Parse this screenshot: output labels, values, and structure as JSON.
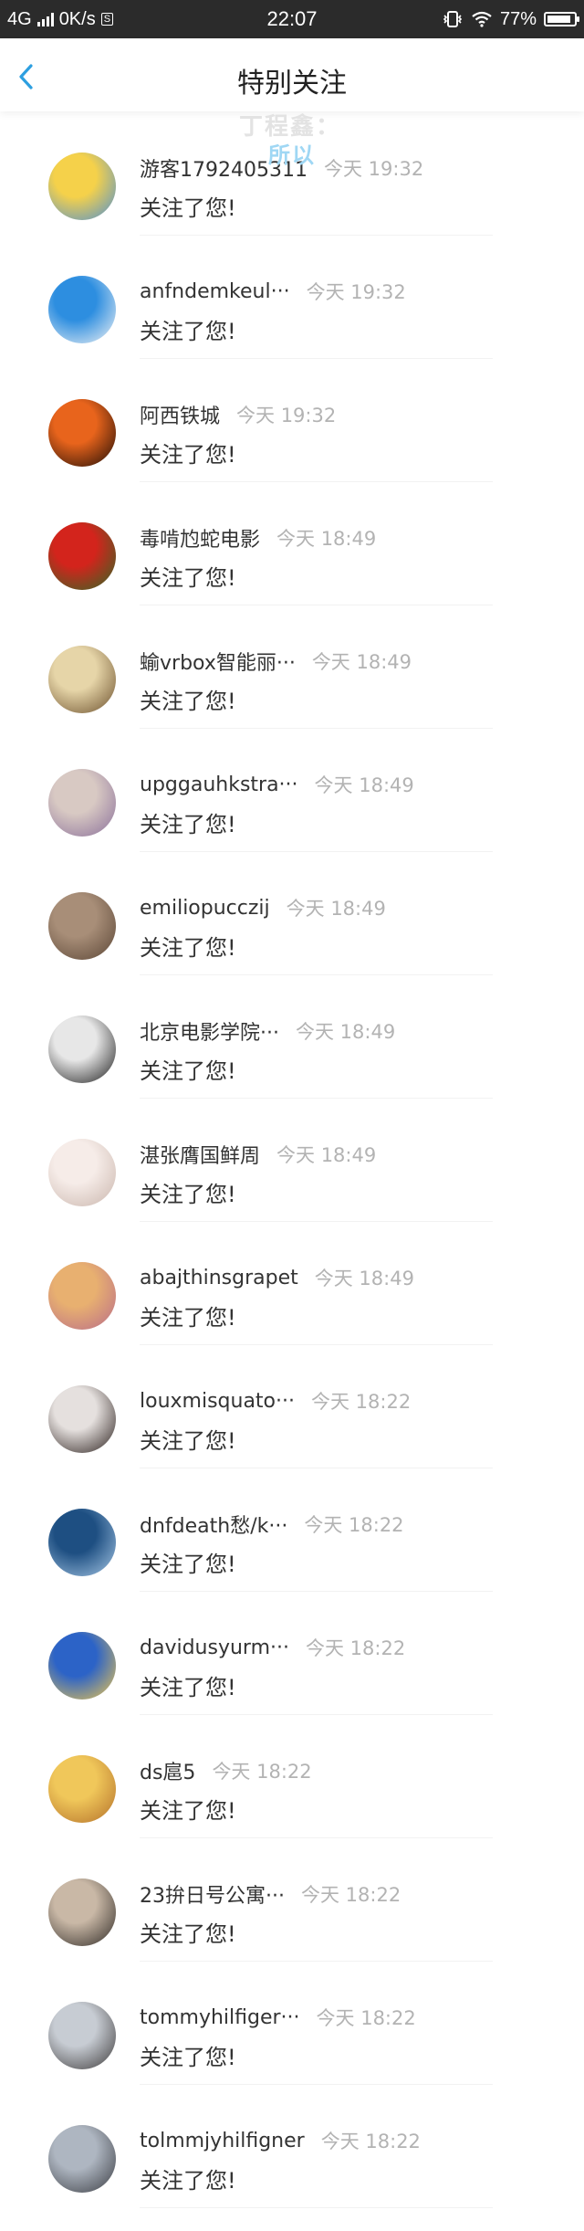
{
  "status_bar": {
    "network": "4G",
    "speed": "0K/s",
    "s_badge": "S",
    "time": "22:07",
    "battery": "77%",
    "battery_level": 0.77
  },
  "header": {
    "title": "特别关注"
  },
  "overlay": {
    "line1": "丁程鑫：",
    "line2": "所以"
  },
  "items": [
    {
      "name": "游客1792405311",
      "time": "今天 19:32",
      "message": "关注了您!",
      "avatar_colors": [
        "#f5d14a",
        "#4c8fd6"
      ]
    },
    {
      "name": "anfndemkeul···",
      "time": "今天 19:32",
      "message": "关注了您!",
      "avatar_colors": [
        "#2d8ee0",
        "#f4f4f4"
      ]
    },
    {
      "name": "阿西铁城",
      "time": "今天 19:32",
      "message": "关注了您!",
      "avatar_colors": [
        "#e8641c",
        "#1b0b05"
      ]
    },
    {
      "name": "毒啃尥蛇电影",
      "time": "今天 18:49",
      "message": "关注了您!",
      "avatar_colors": [
        "#d3241c",
        "#2d6a25"
      ]
    },
    {
      "name": "蝓vrbox智能丽···",
      "time": "今天 18:49",
      "message": "关注了您!",
      "avatar_colors": [
        "#e6d5a8",
        "#6b4f2c"
      ]
    },
    {
      "name": "upggauhkstra···",
      "time": "今天 18:49",
      "message": "关注了您!",
      "avatar_colors": [
        "#d8c9c3",
        "#8a6f9a"
      ]
    },
    {
      "name": "emiliopucczij",
      "time": "今天 18:49",
      "message": "关注了您!",
      "avatar_colors": [
        "#a88e78",
        "#5a4535"
      ]
    },
    {
      "name": "北京电影学院···",
      "time": "今天 18:49",
      "message": "关注了您!",
      "avatar_colors": [
        "#e7e7e7",
        "#1c1c1c"
      ]
    },
    {
      "name": "湛张膺国鲜周",
      "time": "今天 18:49",
      "message": "关注了您!",
      "avatar_colors": [
        "#f6ece8",
        "#c9b5ac"
      ]
    },
    {
      "name": "abajthinsgrapet",
      "time": "今天 18:49",
      "message": "关注了您!",
      "avatar_colors": [
        "#e8b070",
        "#b86b8a"
      ]
    },
    {
      "name": "louxmisquato···",
      "time": "今天 18:22",
      "message": "关注了您!",
      "avatar_colors": [
        "#e5e0de",
        "#2a1f1c"
      ]
    },
    {
      "name": "dnfdeath愁/k···",
      "time": "今天 18:22",
      "message": "关注了您!",
      "avatar_colors": [
        "#1e4f82",
        "#a7c8e6"
      ]
    },
    {
      "name": "davidusyurm···",
      "time": "今天 18:22",
      "message": "关注了您!",
      "avatar_colors": [
        "#2c63c7",
        "#f2c94c"
      ]
    },
    {
      "name": "ds扈5",
      "time": "今天 18:22",
      "message": "关注了您!",
      "avatar_colors": [
        "#f0c75a",
        "#b36f2a"
      ]
    },
    {
      "name": "23拚日号公寓···",
      "time": "今天 18:22",
      "message": "关注了您!",
      "avatar_colors": [
        "#c9b8a6",
        "#2f2a26"
      ]
    },
    {
      "name": "tommyhilfiger···",
      "time": "今天 18:22",
      "message": "关注了您!",
      "avatar_colors": [
        "#c7ccd3",
        "#3d3a3a"
      ]
    },
    {
      "name": "tolmmjyhilfigner",
      "time": "今天 18:22",
      "message": "关注了您!",
      "avatar_colors": [
        "#aeb6c1",
        "#3a3c42"
      ]
    }
  ]
}
